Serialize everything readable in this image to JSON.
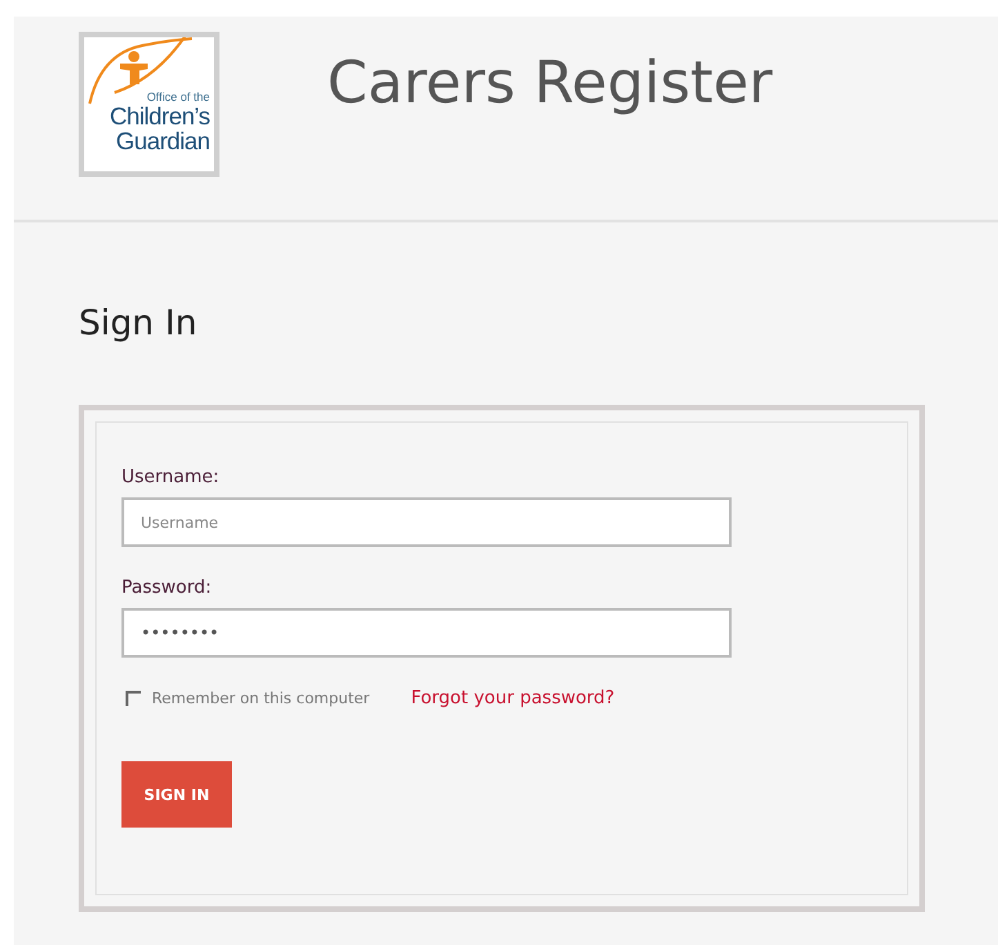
{
  "header": {
    "logo_lines": [
      "Office of the",
      "Children’s",
      "Guardian"
    ],
    "title": "Carers Register"
  },
  "heading": "Sign In",
  "form": {
    "fields": [
      {
        "label": "Username:",
        "placeholder": "Username"
      },
      {
        "label": "Password:",
        "value": "••••••••"
      }
    ],
    "remember": {
      "label": "Remember on this computer",
      "checked": false
    },
    "forgot_link": "Forgot your password?",
    "submit": "SIGN IN"
  }
}
